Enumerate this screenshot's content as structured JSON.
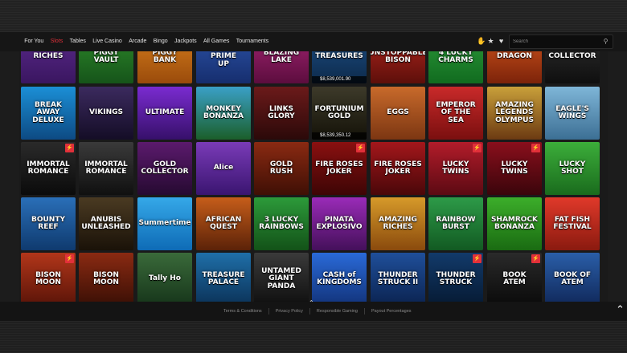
{
  "nav": {
    "items": [
      "For You",
      "Slots",
      "Tables",
      "Live Casino",
      "Arcade",
      "Bingo",
      "Jackpots",
      "All Games",
      "Tournaments"
    ],
    "active": "Slots"
  },
  "search": {
    "placeholder": "Search"
  },
  "toolbar_icons": [
    "hand-icon",
    "star-icon",
    "heart-icon"
  ],
  "colors": {
    "accent": "#e1303a"
  },
  "games": [
    {
      "title": "RICHES",
      "bg": "linear-gradient(#5b2a8c,#3a1660)"
    },
    {
      "title": "PIGGY\nVAULT",
      "bg": "linear-gradient(#2d8a2a,#16541a)"
    },
    {
      "title": "PIGGY\nBANK",
      "bg": "linear-gradient(#d77f1d,#9a4b0b)"
    },
    {
      "title": "WOLF PRIME\nUP",
      "bg": "linear-gradient(#2c53a8,#162e6e)"
    },
    {
      "title": "BLAZING\nLAKE",
      "bg": "linear-gradient(#a32472,#5c0d3e)"
    },
    {
      "title": "TREASURES",
      "bg": "linear-gradient(#1d4f86,#0d2a4b)",
      "jackpot": "$8,539,001.90"
    },
    {
      "title": "UNSTOPPABLE\nBISON",
      "bg": "linear-gradient(#b4261f,#5d0f0a)"
    },
    {
      "title": "4 LUCKY\nCHARMS",
      "bg": "linear-gradient(#2d9a3a,#116b1f)"
    },
    {
      "title": "DRAGON",
      "bg": "linear-gradient(#d1551c,#7c230a)"
    },
    {
      "title": "COLLECTOR",
      "bg": "linear-gradient(#2f2f2f,#0f0f0f)"
    },
    {
      "title": "BREAK\nAWAY\nDELUXE",
      "bg": "linear-gradient(#1b8fd6,#0d4a83)"
    },
    {
      "title": "VIKINGS",
      "bg": "linear-gradient(#3b2a5e,#140d26)"
    },
    {
      "title": "ULTIMATE",
      "bg": "linear-gradient(#7a2bd0,#36106a)"
    },
    {
      "title": "MONKEY\nBONANZA",
      "bg": "linear-gradient(#3aa0c7,#1b5f2a)"
    },
    {
      "title": "LINKS\nGLORY",
      "bg": "linear-gradient(#6b1a1a,#2b0909)"
    },
    {
      "title": "FORTUNIUM\nGOLD",
      "bg": "linear-gradient(#3d3a2a,#141208)",
      "jackpot": "$8,539,350.12"
    },
    {
      "title": "EGGS",
      "bg": "linear-gradient(#c86a2b,#7c3612)"
    },
    {
      "title": "EMPEROR\nOF THE\nSEA",
      "bg": "linear-gradient(#c92a2a,#7a0f0f)"
    },
    {
      "title": "AMAZING\nLEGENDS\nOLYMPUS",
      "bg": "linear-gradient(#c9a03a,#6c3a12)"
    },
    {
      "title": "EAGLE'S WINGS",
      "bg": "linear-gradient(#7fb6d8,#3c6f94)"
    },
    {
      "title": "IMMORTAL\nROMANCE",
      "bg": "linear-gradient(#2a2a2a,#0b0b0b)",
      "badge": true
    },
    {
      "title": "IMMORTAL\nROMANCE",
      "bg": "linear-gradient(#3a3a3a,#101010)"
    },
    {
      "title": "GOLD\nCOLLECTOR",
      "bg": "linear-gradient(#5b1a6d,#260a31)"
    },
    {
      "title": "Alice",
      "bg": "linear-gradient(#7a3bb8,#3a1570)"
    },
    {
      "title": "GOLD\nRUSH",
      "bg": "linear-gradient(#8a2a12,#3f0f05)"
    },
    {
      "title": "FIRE ROSES\nJOKER",
      "bg": "linear-gradient(#8a1010,#3d0505)",
      "badge": true
    },
    {
      "title": "FIRE ROSES\nJOKER",
      "bg": "linear-gradient(#a3171b,#4a0709)"
    },
    {
      "title": "LUCKY TWINS",
      "bg": "linear-gradient(#b21c2a,#5c0a13)",
      "badge": true
    },
    {
      "title": "LUCKY TWINS",
      "bg": "linear-gradient(#8a0f1c,#3a050b)",
      "badge": true
    },
    {
      "title": "LUCKY\nSHOT",
      "bg": "linear-gradient(#3cae3a,#1a6b1d)"
    },
    {
      "title": "BOUNTY\nREEF",
      "bg": "linear-gradient(#2a6fb8,#0f3a6e)"
    },
    {
      "title": "ANUBIS\nUNLEASHED",
      "bg": "linear-gradient(#4a3a22,#1a1208)"
    },
    {
      "title": "Summertime",
      "bg": "linear-gradient(#35a8e8,#0e6bb6)"
    },
    {
      "title": "AFRICAN\nQUEST",
      "bg": "linear-gradient(#c65d1a,#5b2208)"
    },
    {
      "title": "3 LUCKY\nRAINBOWS",
      "bg": "linear-gradient(#2c9a3a,#135218)"
    },
    {
      "title": "PINATA\nEXPLOSIVO",
      "bg": "linear-gradient(#9a2bb8,#44105a)"
    },
    {
      "title": "AMAZING\nRICHES",
      "bg": "linear-gradient(#d69a2a,#8a4a0d)"
    },
    {
      "title": "RAINBOW\nBURST",
      "bg": "linear-gradient(#2d9a48,#125a22)"
    },
    {
      "title": "SHAMROCK\nBONANZA",
      "bg": "linear-gradient(#3cae2a,#1a6b12)"
    },
    {
      "title": "FAT FISH\nFESTIVAL",
      "bg": "linear-gradient(#e0392a,#8a1a0f)"
    },
    {
      "title": "BISON\nMOON",
      "bg": "linear-gradient(#b2361a,#5a1408)",
      "badge": true
    },
    {
      "title": "BISON\nMOON",
      "bg": "linear-gradient(#8a2a12,#3a0f05)"
    },
    {
      "title": "Tally Ho",
      "bg": "linear-gradient(#3a6a3a,#16351a)"
    },
    {
      "title": "TREASURE\nPALACE",
      "bg": "linear-gradient(#1f6fa8,#0b3258)"
    },
    {
      "title": "UNTAMED\nGIANT\nPANDA",
      "bg": "linear-gradient(#3a3a3a,#0f0f0f)"
    },
    {
      "title": "CASH of\nKINGDOMS",
      "bg": "linear-gradient(#2a6ad8,#12337a)"
    },
    {
      "title": "THUNDER\nSTRUCK II",
      "bg": "linear-gradient(#1f4f9a,#0b2350)"
    },
    {
      "title": "THUNDER\nSTRUCK",
      "bg": "linear-gradient(#123a6a,#061a33)",
      "badge": true
    },
    {
      "title": "BOOK\nATEM",
      "bg": "linear-gradient(#2a2a2a,#0a0a0a)",
      "badge": true
    },
    {
      "title": "BOOK OF\nATEM",
      "bg": "linear-gradient(#2a5ea8,#10285a)"
    }
  ],
  "footer": {
    "links": [
      "Terms & Conditions",
      "Privacy Policy",
      "Responsible Gaming",
      "Payout Percentages"
    ]
  }
}
